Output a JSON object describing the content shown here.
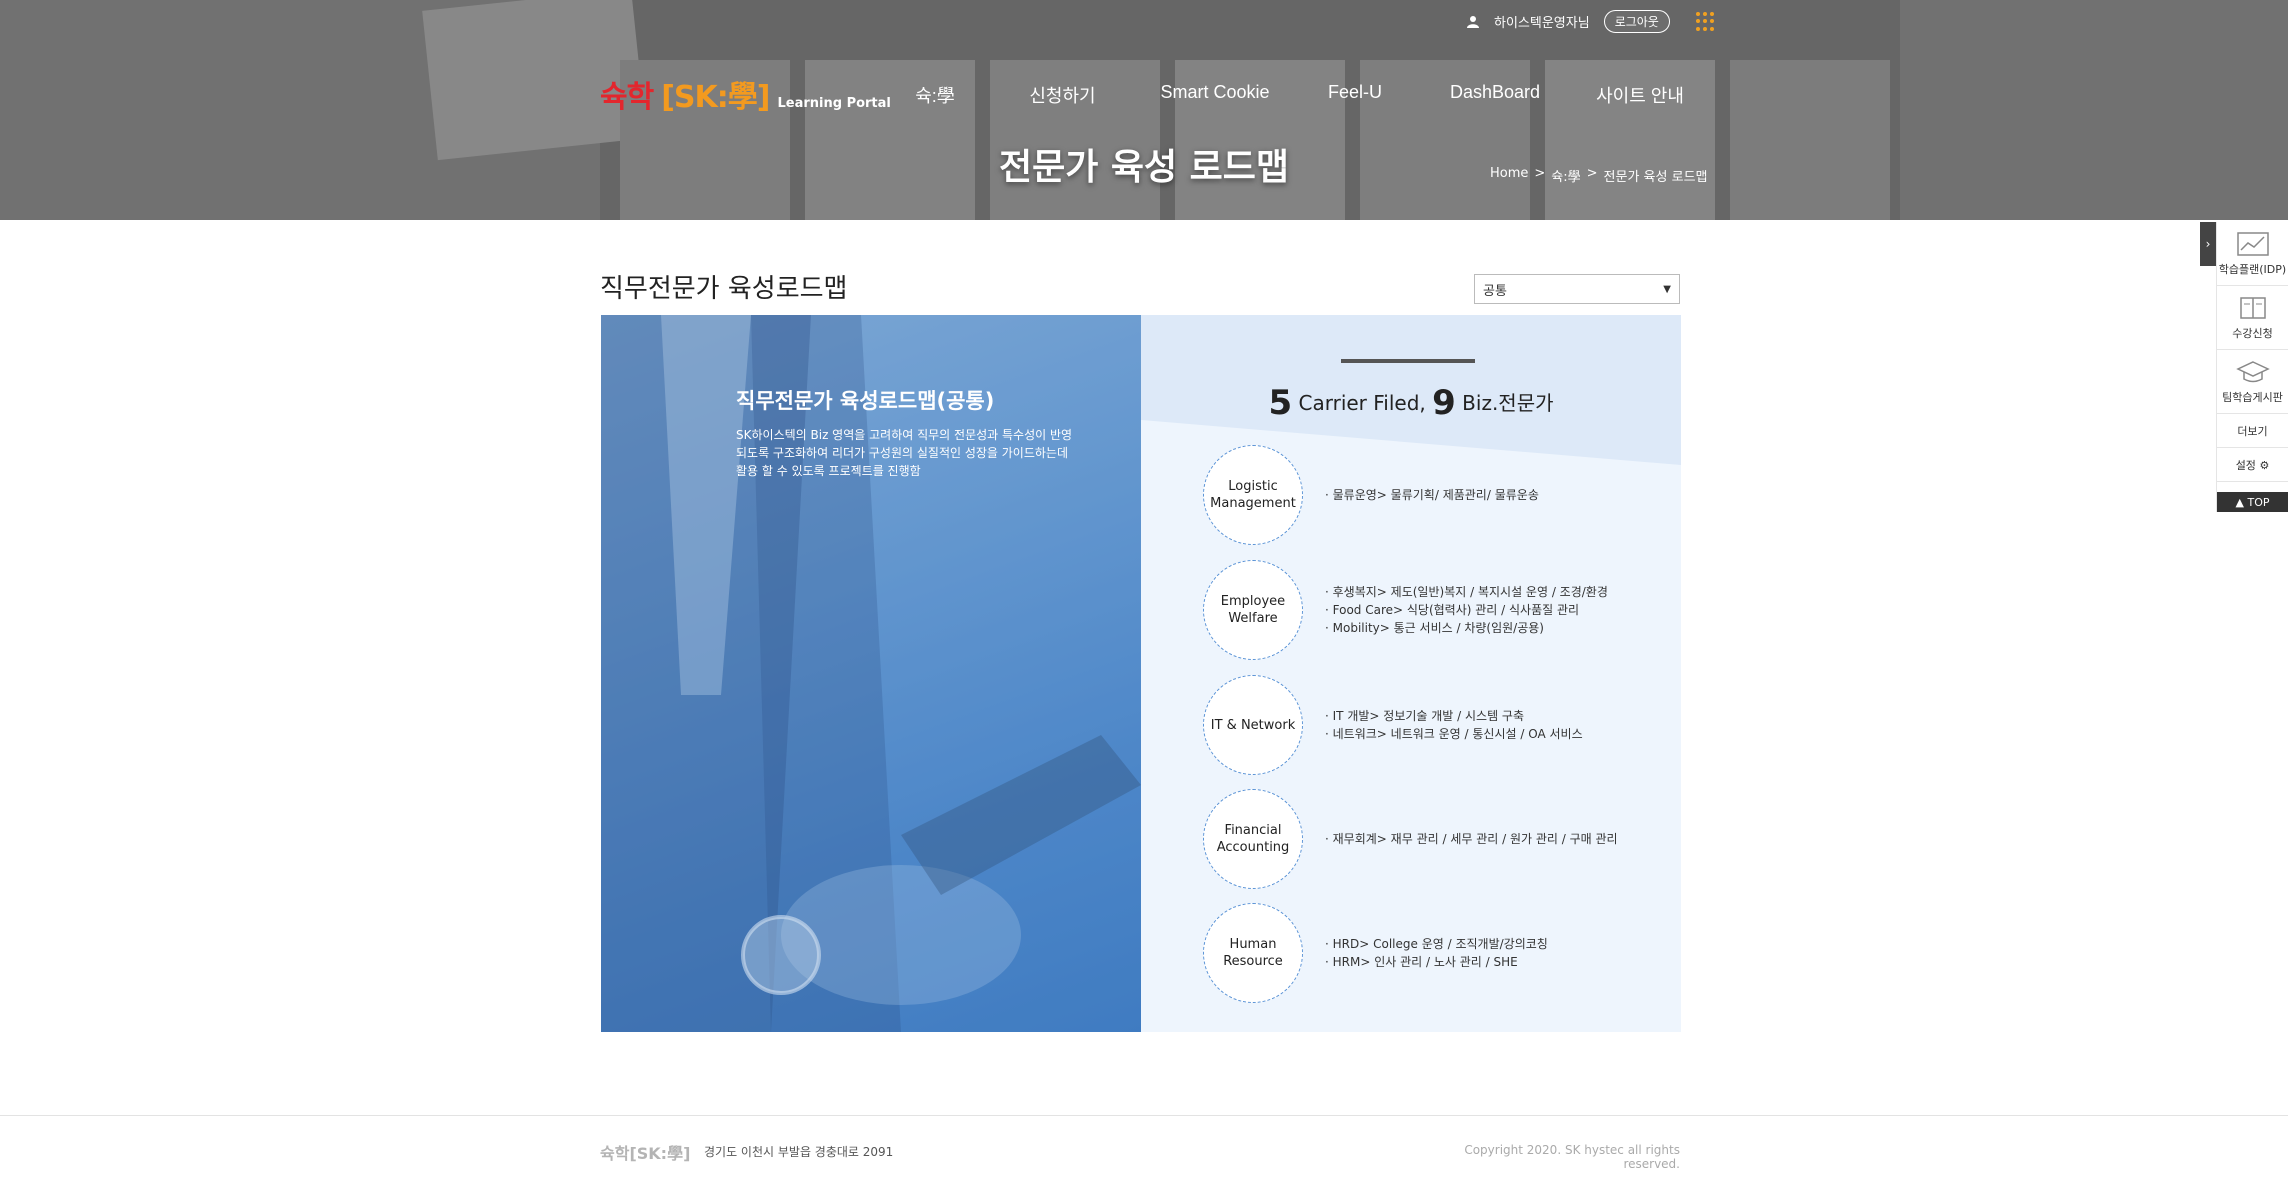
{
  "header": {
    "user_name": "하이스텍운영자님",
    "logout_label": "로그아웃",
    "logo": {
      "part1": "슉학",
      "part2": "[SK:學]",
      "sub": "Learning Portal"
    },
    "nav": [
      "슉:學",
      "신청하기",
      "Smart Cookie",
      "Feel-U",
      "DashBoard",
      "사이트 안내"
    ],
    "hero_title": "전문가 육성 로드맵",
    "breadcrumb": {
      "home": "Home",
      "sep": ">",
      "level1": "슉:學",
      "current": "전문가 육성 로드맵"
    }
  },
  "content": {
    "page_title": "직무전문가 육성로드맵",
    "select": {
      "value": "공통"
    },
    "left": {
      "title": "직무전문가 육성로드맵(공통)",
      "desc": "SK하이스텍의 Biz 영역을 고려하여 직무의 전문성과 특수성이 반영되도록 구조화하여 리더가 구성원의 실질적인 성장을 가이드하는데 활용 할 수 있도록 프로젝트를 진행함"
    },
    "right": {
      "headline": {
        "num1": "5",
        "text1": " Carrier Filed, ",
        "num2": "9",
        "text2": " Biz.전문가"
      },
      "fields": [
        {
          "name_line1": "Logistic",
          "name_line2": "Management",
          "items": [
            "물류운영> 물류기획/ 제품관리/ 물류운송"
          ]
        },
        {
          "name_line1": "Employee",
          "name_line2": "Welfare",
          "items": [
            "후생복지> 제도(일반)복지 / 복지시설 운영 / 조경/환경",
            "Food Care> 식당(협력사) 관리 / 식사품질 관리",
            "Mobility> 통근 서비스 / 차량(임원/공용)"
          ]
        },
        {
          "name_line1": "IT & Network",
          "name_line2": "",
          "items": [
            "IT 개발> 정보기술 개발 / 시스템 구축",
            "네트워크> 네트워크 운영 / 통신시설 / OA 서비스"
          ]
        },
        {
          "name_line1": "Financial",
          "name_line2": "Accounting",
          "items": [
            "재무회계> 재무 관리 / 세무 관리 / 원가 관리 / 구매 관리"
          ]
        },
        {
          "name_line1": "Human",
          "name_line2": "Resource",
          "items": [
            "HRD> College 운영 / 조직개발/강의코칭",
            "HRM> 인사 관리 / 노사 관리 / SHE"
          ]
        }
      ]
    }
  },
  "quick_menu": {
    "items": [
      "학습플랜(IDP)",
      "수강신청",
      "팀학습게시판"
    ],
    "more": "더보기",
    "settings": "설정",
    "top": "TOP"
  },
  "footer": {
    "logo": "슉학[SK:學]",
    "address": "경기도 이천시 부발읍 경충대로 2091",
    "copyright": "Copyright 2020. SK hystec all rights reserved."
  },
  "colors": {
    "accent_red": "#e3262d",
    "accent_orange": "#f39a1f",
    "circle_border": "#5a93d6",
    "panel_blue": "#4f88c9"
  }
}
